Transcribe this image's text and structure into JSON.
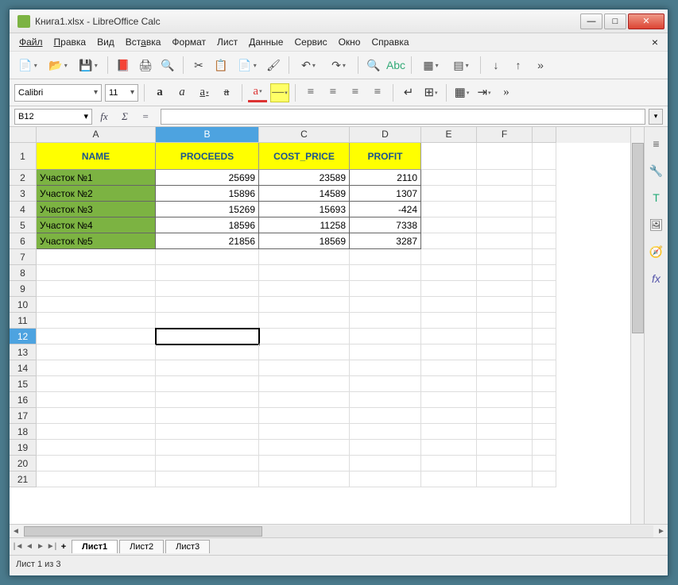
{
  "title": "Книга1.xlsx - LibreOffice Calc",
  "menu": {
    "file": "Файл",
    "edit": "Правка",
    "view": "Вид",
    "insert": "Вставка",
    "format": "Формат",
    "sheet": "Лист",
    "data": "Данные",
    "service": "Сервис",
    "window": "Окно",
    "help": "Справка"
  },
  "font": {
    "name": "Calibri",
    "size": "11"
  },
  "namebox": "B12",
  "columns": [
    "A",
    "B",
    "C",
    "D",
    "E",
    "F"
  ],
  "headers": {
    "name": "NAME",
    "proceeds": "PROCEEDS",
    "cost": "COST_PRICE",
    "profit": "PROFIT"
  },
  "rows": [
    {
      "name": "Участок №1",
      "proceeds": "25699",
      "cost": "23589",
      "profit": "2110"
    },
    {
      "name": "Участок №2",
      "proceeds": "15896",
      "cost": "14589",
      "profit": "1307"
    },
    {
      "name": "Участок №3",
      "proceeds": "15269",
      "cost": "15693",
      "profit": "-424"
    },
    {
      "name": "Участок №4",
      "proceeds": "18596",
      "cost": "11258",
      "profit": "7338"
    },
    {
      "name": "Участок №5",
      "proceeds": "21856",
      "cost": "18569",
      "profit": "3287"
    }
  ],
  "tabs": {
    "s1": "Лист1",
    "s2": "Лист2",
    "s3": "Лист3"
  },
  "status": "Лист 1 из 3",
  "chart_data": {
    "type": "table",
    "columns": [
      "NAME",
      "PROCEEDS",
      "COST_PRICE",
      "PROFIT"
    ],
    "rows": [
      [
        "Участок №1",
        25699,
        23589,
        2110
      ],
      [
        "Участок №2",
        15896,
        14589,
        1307
      ],
      [
        "Участок №3",
        15269,
        15693,
        -424
      ],
      [
        "Участок №4",
        18596,
        11258,
        7338
      ],
      [
        "Участок №5",
        21856,
        18569,
        3287
      ]
    ]
  }
}
